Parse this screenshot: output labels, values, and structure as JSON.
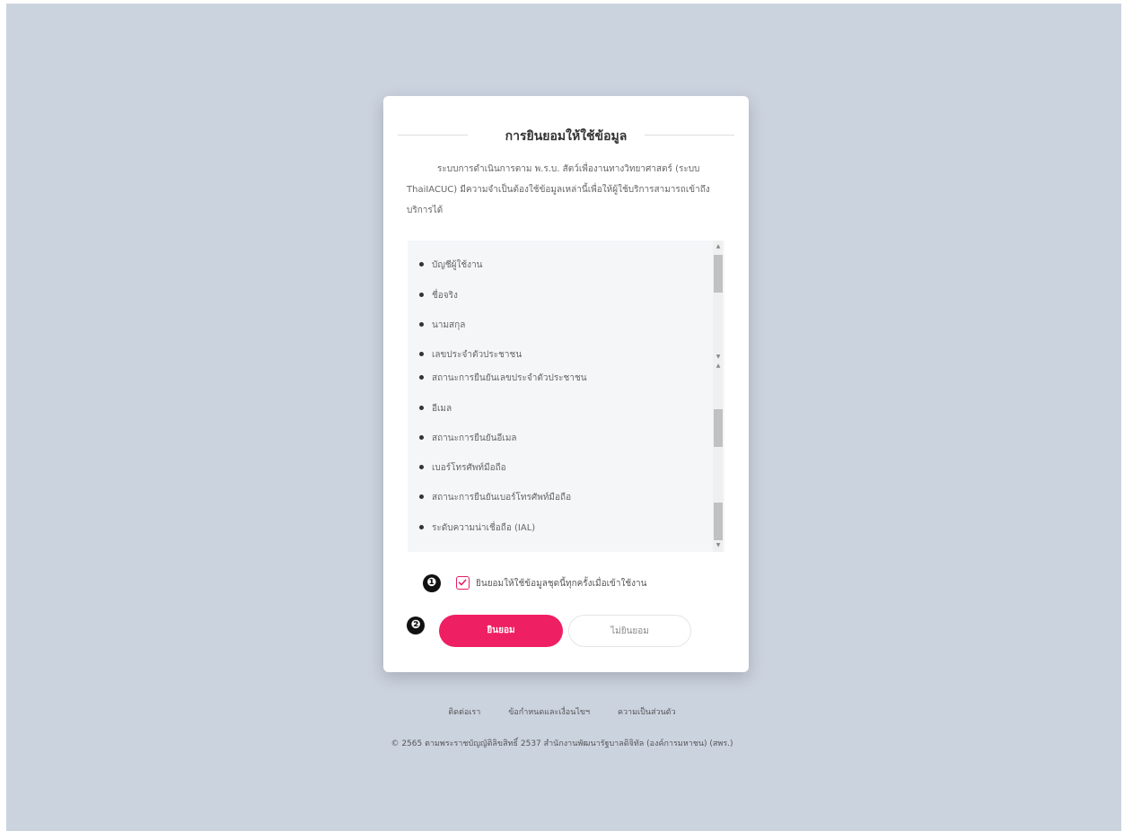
{
  "dialog": {
    "title": "การยินยอมให้ใช้ข้อมูล",
    "intro": "ระบบการดำเนินการตาม พ.ร.บ. สัตว์เพื่องานทางวิทยาศาสตร์ (ระบบ ThaiIACUC) มีความจำเป็นต้องใช้ข้อมูลเหล่านี้เพื่อให้ผู้ใช้บริการสามารถเข้าถึงบริการได้",
    "items": [
      "บัญชีผู้ใช้งาน",
      "ชื่อจริง",
      "นามสกุล",
      "เลขประจำตัวประชาชน",
      "สถานะการยืนยันเลขประจำตัวประชาชน",
      "อีเมล",
      "สถานะการยืนยันอีเมล",
      "เบอร์โทรศัพท์มือถือ",
      "สถานะการยืนยันเบอร์โทรศัพท์มือถือ",
      "ระดับความน่าเชื่อถือ (IAL)"
    ],
    "consent_checkbox": {
      "label": "ยินยอมให้ใช้ข้อมูลชุดนี้ทุกครั้งเมื่อเข้าใช้งาน",
      "checked": true
    },
    "accept_label": "ยินยอม",
    "decline_label": "ไม่ยินยอม"
  },
  "annotations": {
    "marker1": "❶",
    "marker2": "❷"
  },
  "footer": {
    "links": [
      "ติดต่อเรา",
      "ข้อกำหนดและเงื่อนไขฯ",
      "ความเป็นส่วนตัว"
    ],
    "copyright": "© 2565 ตามพระราชบัญญัติลิขสิทธิ์ 2537 สำนักงานพัฒนารัฐบาลดิจิทัล (องค์การมหาชน) (สพร.)"
  },
  "colors": {
    "accent": "#ef1f63",
    "page_bg": "#cbd3df"
  }
}
